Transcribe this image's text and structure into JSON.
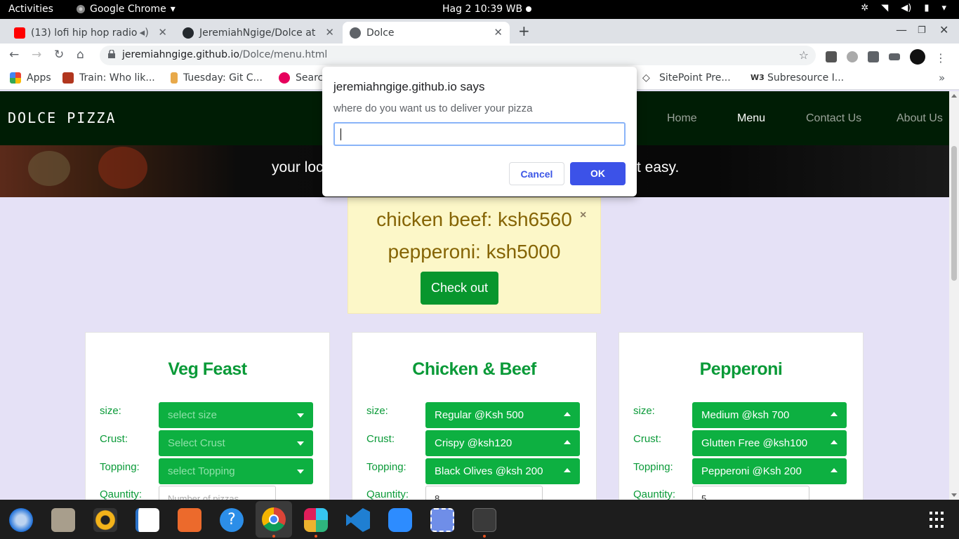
{
  "system_bar": {
    "activities": "Activities",
    "app_name": "Google Chrome",
    "clock": "Hag 2  10:39 WB"
  },
  "tabs": [
    {
      "label": "(13) lofi hip hop radio",
      "icon": "youtube-icon"
    },
    {
      "label": "JeremiahNgige/Dolce at",
      "icon": "github-icon"
    },
    {
      "label": "Dolce",
      "icon": "globe-icon"
    }
  ],
  "toolbar": {
    "url_domain": "jeremiahngige.github.io",
    "url_path": "/Dolce/menu.html"
  },
  "bookmarks": [
    {
      "label": "Apps",
      "icon": "apps-grid-icon"
    },
    {
      "label": "Train: Who lik...",
      "icon": "codewars-icon"
    },
    {
      "label": "Tuesday: Git C...",
      "icon": "moringa-icon"
    },
    {
      "label": "Searc",
      "icon": "circle-icon"
    },
    {
      "label": "SitePoint Pre...",
      "icon": "sitepoint-icon"
    },
    {
      "label": "Subresource I...",
      "icon": "w3-icon"
    }
  ],
  "site": {
    "brand": "DOLCE PIZZA",
    "nav": [
      "Home",
      "Menu",
      "Contact Us",
      "About Us"
    ],
    "hero_left": "your loc",
    "hero_right": "t easy."
  },
  "cart_alert": {
    "line1": "chicken beef: ksh6560",
    "line2": "pepperoni: ksh5000",
    "close": "×",
    "checkout": "Check out"
  },
  "cards": [
    {
      "title": "Veg Feast",
      "labels": {
        "size": "size:",
        "crust": "Crust:",
        "topping": "Topping:",
        "quantity": "Qauntity:"
      },
      "size": "select size",
      "crust": "Select Crust",
      "topping": "select Topping",
      "quantity_placeholder": "Number of pizzas",
      "quantity_value": ""
    },
    {
      "title": "Chicken & Beef",
      "labels": {
        "size": "size:",
        "crust": "Crust:",
        "topping": "Topping:",
        "quantity": "Qauntity:"
      },
      "size": "Regular @Ksh 500",
      "crust": "Crispy @ksh120",
      "topping": "Black Olives @ksh 200",
      "quantity_placeholder": "",
      "quantity_value": "8"
    },
    {
      "title": "Pepperoni",
      "labels": {
        "size": "size:",
        "crust": "Crust:",
        "topping": "Topping:",
        "quantity": "Qauntity:"
      },
      "size": "Medium @ksh 700",
      "crust": "Glutten Free @ksh100",
      "topping": "Pepperoni @Ksh 200",
      "quantity_placeholder": "",
      "quantity_value": "5"
    }
  ],
  "dialog": {
    "title": "jeremiahngige.github.io says",
    "message": "where do you want us to deliver your pizza",
    "input_value": "",
    "cancel": "Cancel",
    "ok": "OK"
  },
  "dock_apps": [
    "thunderbird-icon",
    "files-icon",
    "rhythmbox-icon",
    "writer-icon",
    "software-icon",
    "help-icon",
    "chrome-icon",
    "slack-icon",
    "vscode-icon",
    "zoom-icon",
    "screenshot-icon",
    "system-monitor-icon",
    "show-apps-icon"
  ]
}
